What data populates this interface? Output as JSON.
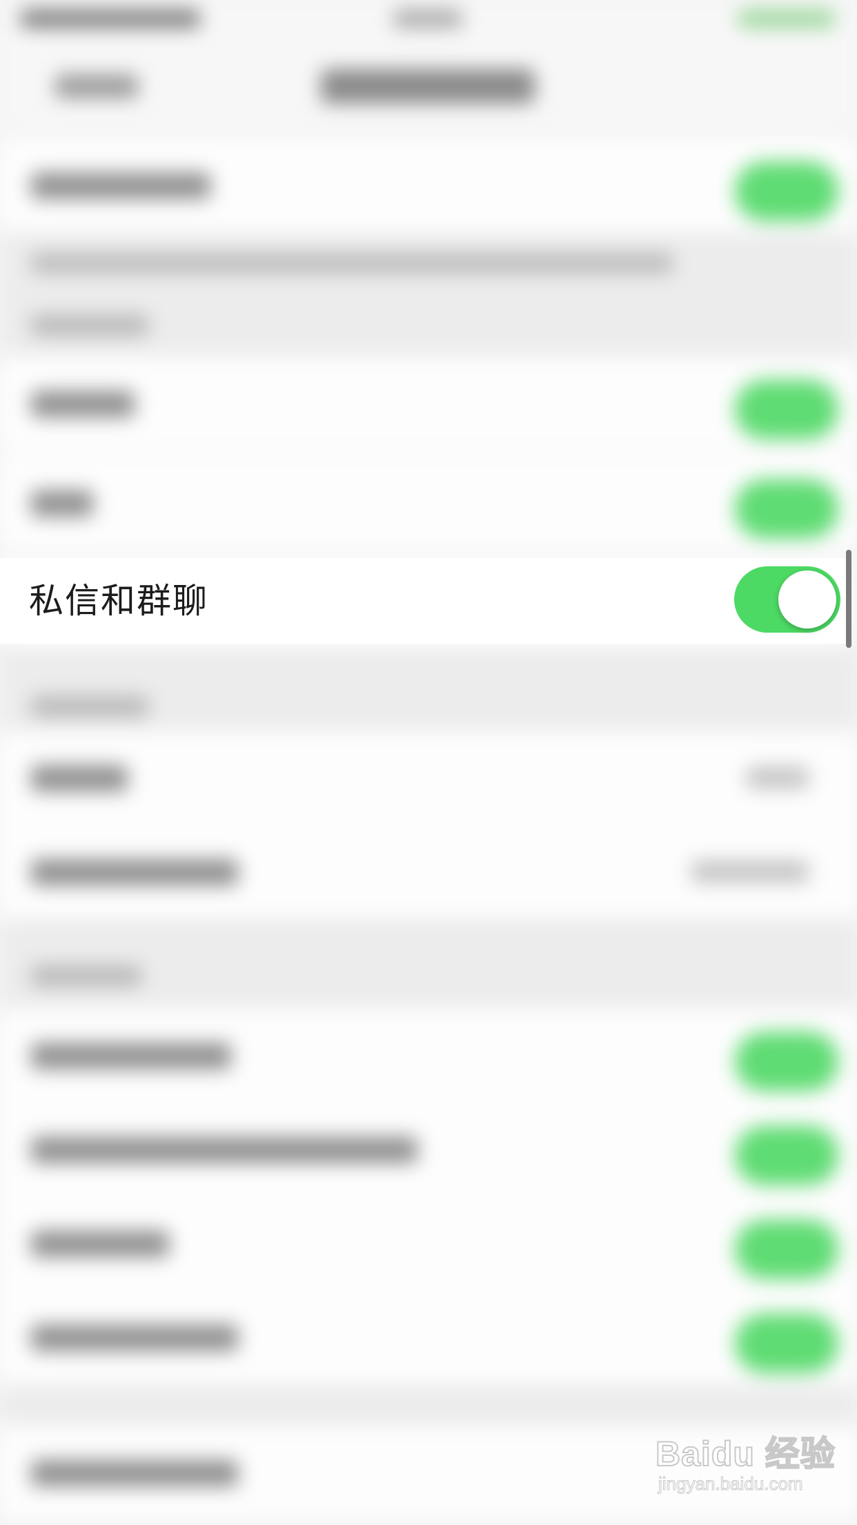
{
  "settings": {
    "focused_row": {
      "label": "私信和群聊",
      "toggle_on": true
    }
  },
  "colors": {
    "toggle_on": "#4cd964",
    "background": "#f4f4f4",
    "row_background": "#ffffff"
  },
  "watermark": {
    "text": "Baidu 经验",
    "url": "jingyan.baidu.com"
  }
}
